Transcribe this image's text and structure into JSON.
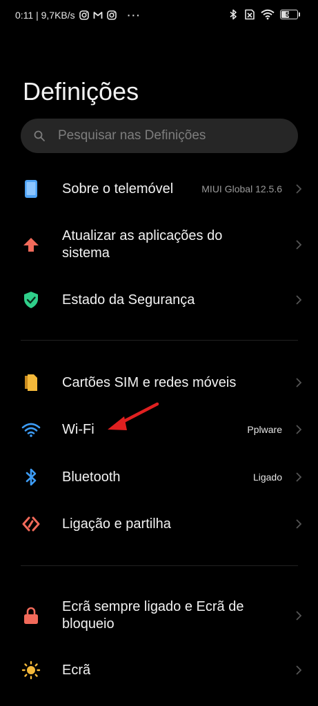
{
  "status_bar": {
    "time_speed": "0:11 | 9,7KB/s",
    "overflow": "···",
    "battery": "56",
    "battery_level_percent": 56
  },
  "header": {
    "title": "Definições"
  },
  "search": {
    "placeholder": "Pesquisar nas Definições",
    "icon": "search-icon"
  },
  "items": [
    {
      "label": "Sobre o telemóvel",
      "value": "MIUI Global 12.5.6",
      "icon": "phone-icon",
      "color": "#4ea3f5"
    },
    {
      "label": "Atualizar as aplicações do sistema",
      "value": "",
      "icon": "arrow-up-icon",
      "color": "#f26a5a"
    },
    {
      "label": "Estado da Segurança",
      "value": "",
      "icon": "shield-check-icon",
      "color": "#2fcf8a"
    },
    {
      "label": "Cartões SIM e redes móveis",
      "value": "",
      "icon": "sim-card-icon",
      "color": "#f5b93a"
    },
    {
      "label": "Wi-Fi",
      "value": "Pplware",
      "icon": "wifi-icon",
      "color": "#3d9cf5"
    },
    {
      "label": "Bluetooth",
      "value": "Ligado",
      "icon": "bluetooth-icon",
      "color": "#3d9cf5"
    },
    {
      "label": "Ligação e partilha",
      "value": "",
      "icon": "connection-share-icon",
      "color": "#f26a5a"
    },
    {
      "label": "Ecrã sempre ligado e Ecrã de bloqueio",
      "value": "",
      "icon": "lock-icon",
      "color": "#f26a5a"
    },
    {
      "label": "Ecrã",
      "value": "",
      "icon": "sun-icon",
      "color": "#f5b93a"
    }
  ],
  "annotation": {
    "arrow_color": "#e02020"
  }
}
